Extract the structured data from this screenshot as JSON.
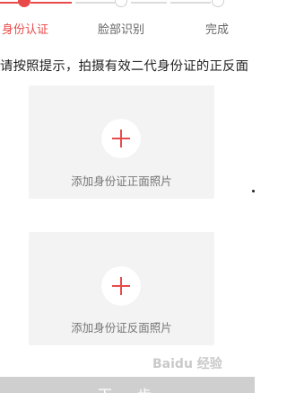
{
  "steps": [
    {
      "label": "身份认证",
      "state": "active"
    },
    {
      "label": "脸部识别",
      "state": "pending"
    },
    {
      "label": "完成",
      "state": "pending"
    }
  ],
  "instruction": "请按照提示，拍摄有效二代身份证的正反面",
  "cards": {
    "front_label": "添加身份证正面照片",
    "back_label": "添加身份证反面照片"
  },
  "next_button": "下一步",
  "watermark": "Baidu 经验",
  "colors": {
    "accent": "#e84a4a",
    "card_bg": "#f3f3f4",
    "button_bg": "#cfcfcf"
  }
}
